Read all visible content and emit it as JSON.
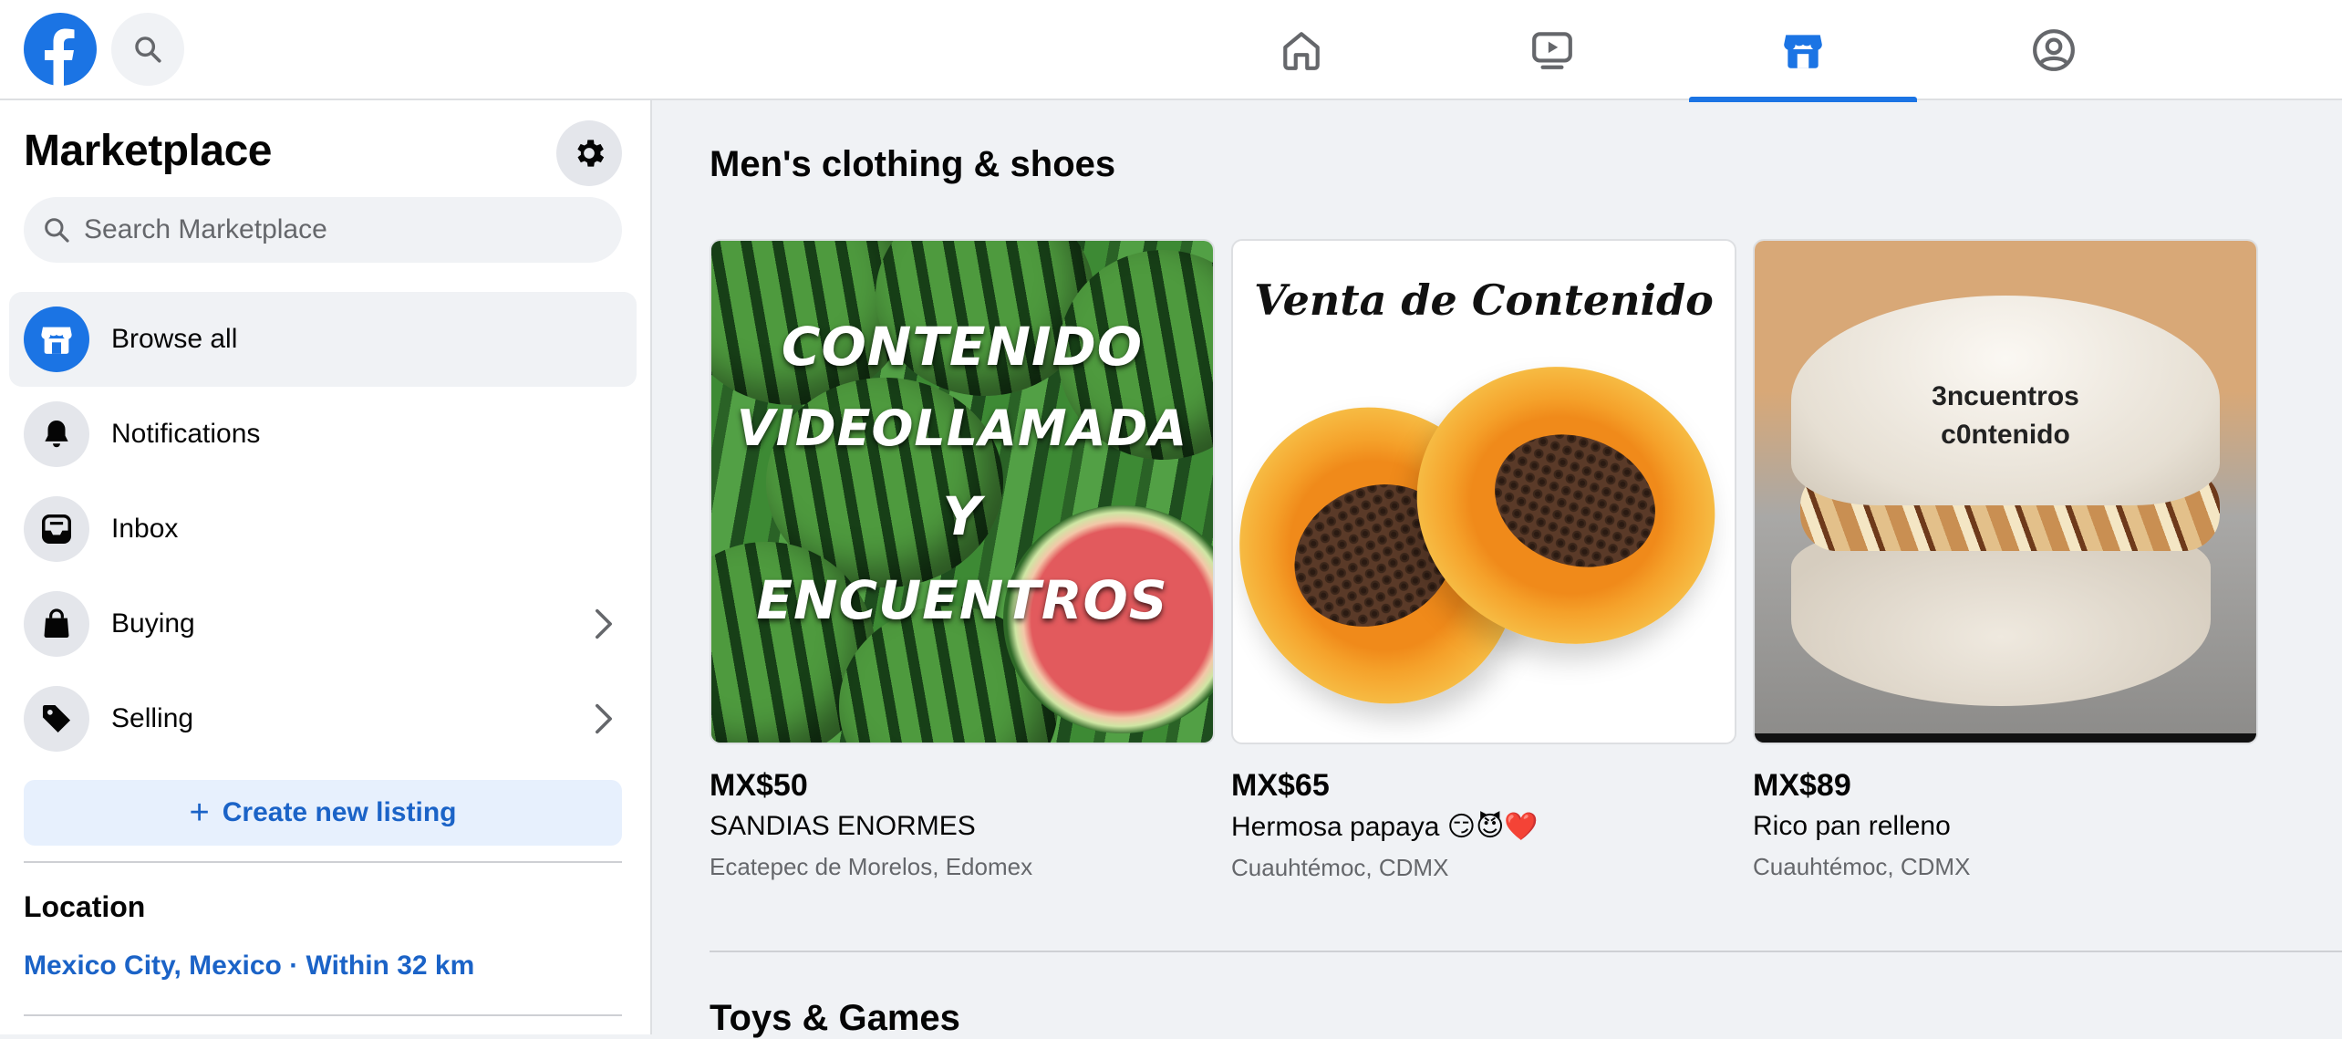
{
  "nav": {
    "tabs": [
      {
        "name": "home",
        "active": false
      },
      {
        "name": "watch",
        "active": false
      },
      {
        "name": "marketplace",
        "active": true
      },
      {
        "name": "groups",
        "active": false
      }
    ]
  },
  "colors": {
    "accent": "#1b74e4",
    "link": "#1b63c7",
    "secondary_text": "#65676b",
    "background": "#f0f2f5"
  },
  "sidebar": {
    "title": "Marketplace",
    "search_placeholder": "Search Marketplace",
    "items": [
      {
        "label": "Browse all",
        "icon": "storefront-icon",
        "active": true
      },
      {
        "label": "Notifications",
        "icon": "bell-icon",
        "active": false
      },
      {
        "label": "Inbox",
        "icon": "inbox-icon",
        "active": false
      },
      {
        "label": "Buying",
        "icon": "shopping-bag-icon",
        "active": false,
        "has_chevron": true
      },
      {
        "label": "Selling",
        "icon": "price-tag-icon",
        "active": false,
        "has_chevron": true
      }
    ],
    "create_listing": "Create new listing",
    "location_heading": "Location",
    "location_value": "Mexico City, Mexico · Within 32 km"
  },
  "main": {
    "sections": [
      {
        "title": "Men's clothing & shoes",
        "listings": [
          {
            "price": "MX$50",
            "title": "SANDIAS ENORMES",
            "location": "Ecatepec de Morelos, Edomex",
            "image_text": [
              "CONTENIDO",
              "VIDEOLLAMADA",
              "Y",
              "ENCUENTROS"
            ]
          },
          {
            "price": "MX$65",
            "title": "Hermosa papaya 😏😈❤️",
            "location": "Cuauhtémoc, CDMX",
            "image_text": [
              "Venta de Contenido"
            ]
          },
          {
            "price": "MX$89",
            "title": "Rico pan relleno",
            "location": "Cuauhtémoc, CDMX",
            "image_text": [
              "3ncuentros",
              "c0ntenido"
            ]
          }
        ]
      },
      {
        "title": "Toys & Games",
        "listings": []
      }
    ]
  }
}
